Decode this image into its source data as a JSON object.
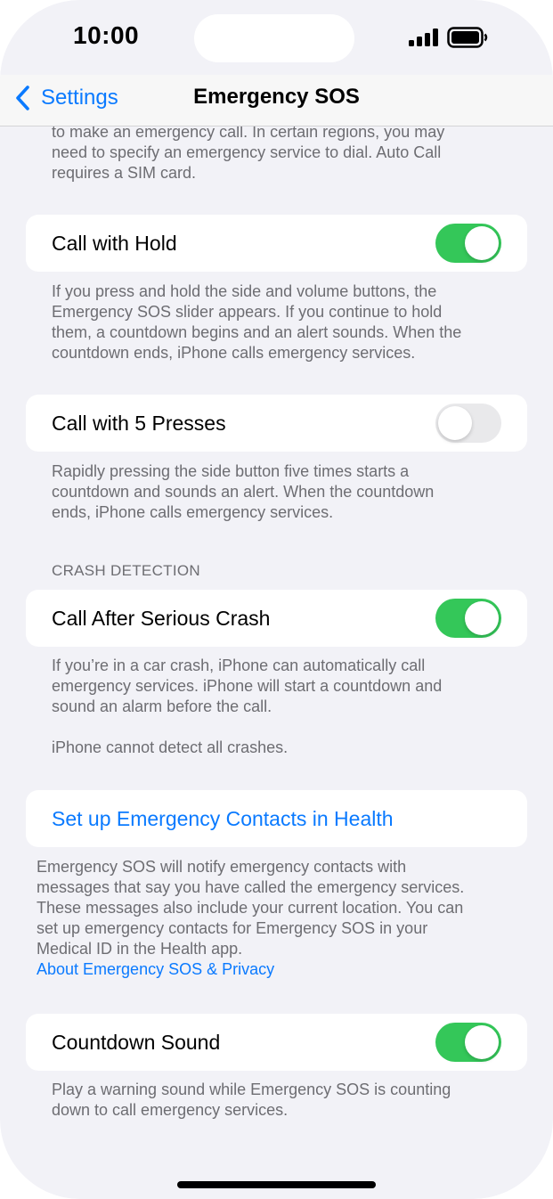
{
  "status_bar": {
    "time": "10:00"
  },
  "nav": {
    "back_label": "Settings",
    "title": "Emergency SOS"
  },
  "intro_footer": {
    "lines": [
      "to make an emergency call. In certain regions, you may",
      "need to specify an emergency service to dial. Auto Call",
      "requires a SIM card."
    ]
  },
  "call_with_hold": {
    "label": "Call with Hold",
    "enabled": true,
    "footer_lines": [
      "If you press and hold the side and volume buttons, the",
      "Emergency SOS slider appears. If you continue to hold",
      "them, a countdown begins and an alert sounds. When the",
      "countdown ends, iPhone calls emergency services."
    ]
  },
  "call_with_5_presses": {
    "label": "Call with 5 Presses",
    "enabled": false,
    "footer_lines": [
      "Rapidly pressing the side button five times starts a",
      "countdown and sounds an alert. When the countdown",
      "ends, iPhone calls emergency services."
    ]
  },
  "crash_detection": {
    "header": "CRASH DETECTION",
    "label": "Call After Serious Crash",
    "enabled": true,
    "footer_lines": [
      "If you’re in a car crash, iPhone can automatically call",
      "emergency services. iPhone will start a countdown and",
      "sound an alarm before the call."
    ],
    "footer_note": "iPhone cannot detect all crashes."
  },
  "emergency_contacts": {
    "link_label": "Set up Emergency Contacts in Health",
    "footer_lines": [
      "Emergency SOS will notify emergency contacts with",
      "messages that say you have called the emergency services.",
      "These messages also include your current location. You can",
      "set up emergency contacts for Emergency SOS in your",
      "Medical ID in the Health app."
    ],
    "privacy_link": "About Emergency SOS & Privacy"
  },
  "countdown_sound": {
    "label": "Countdown Sound",
    "enabled": true,
    "footer_lines": [
      "Play a warning sound while Emergency SOS is counting",
      "down to call emergency services."
    ]
  },
  "colors": {
    "accent": "#0a7aff",
    "switch_on": "#34c759",
    "switch_off": "#e9e9eb",
    "background": "#f2f2f7",
    "secondary_text": "#6d6d72"
  },
  "icons": [
    "signal-icon",
    "battery-icon",
    "chevron-left-icon"
  ]
}
